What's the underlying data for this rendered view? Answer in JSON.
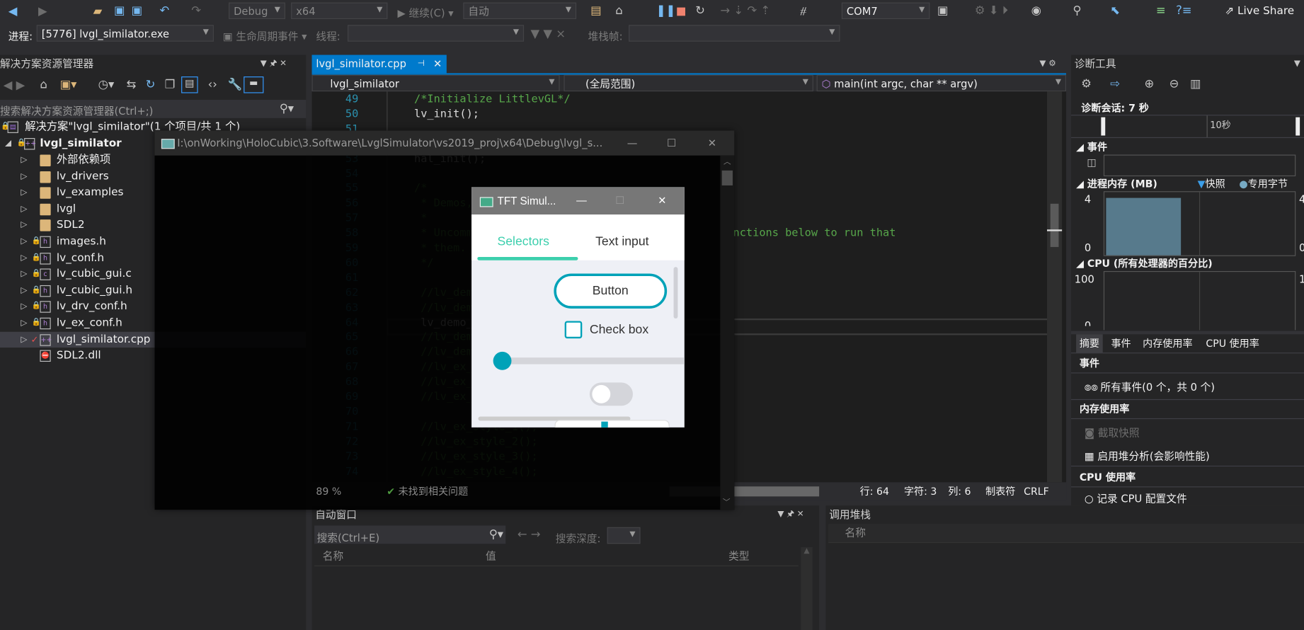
{
  "toolbar": {
    "config": "Debug",
    "platform": "x64",
    "continue": "继续(C)",
    "continue_mode": "自动",
    "device": "COM7",
    "live_share": "Live Share"
  },
  "debug_bar": {
    "process_label": "进程:",
    "process": "[5776] lvgl_similator.exe",
    "lifecycle": "生命周期事件",
    "thread_label": "线程:",
    "thread": "",
    "stack_label": "堆栈帧:",
    "stack": ""
  },
  "solution_explorer": {
    "title": "解决方案资源管理器",
    "search_placeholder": "搜索解决方案资源管理器(Ctrl+;)",
    "solution": "解决方案\"lvgl_similator\"(1 个项目/共 1 个)",
    "project": "lvgl_similator",
    "items": [
      {
        "label": "外部依赖项",
        "type": "deps"
      },
      {
        "label": "lv_drivers",
        "type": "folder"
      },
      {
        "label": "lv_examples",
        "type": "folder"
      },
      {
        "label": "lvgl",
        "type": "folder"
      },
      {
        "label": "SDL2",
        "type": "folder"
      },
      {
        "label": "images.h",
        "type": "h"
      },
      {
        "label": "lv_conf.h",
        "type": "h"
      },
      {
        "label": "lv_cubic_gui.c",
        "type": "c"
      },
      {
        "label": "lv_cubic_gui.h",
        "type": "h"
      },
      {
        "label": "lv_drv_conf.h",
        "type": "h"
      },
      {
        "label": "lv_ex_conf.h",
        "type": "h"
      },
      {
        "label": "lvgl_similator.cpp",
        "type": "cpp",
        "selected": true
      },
      {
        "label": "SDL2.dll",
        "type": "dll"
      }
    ]
  },
  "editor": {
    "tab": "lvgl_similator.cpp",
    "nav_project": "lvgl_similator",
    "nav_scope": "(全局范围)",
    "nav_member": "main(int argc, char ** argv)",
    "lines": [
      {
        "n": "49",
        "t": "/*Initialize LittlevGL*/",
        "c": "cm"
      },
      {
        "n": "50",
        "t": "lv_init();",
        "c": "df"
      },
      {
        "n": "51",
        "t": "",
        "c": "df"
      },
      {
        "n": "52",
        "t": "",
        "c": "cm"
      },
      {
        "n": "53",
        "t": "hal_init();",
        "c": "df"
      },
      {
        "n": "54",
        "t": "",
        "c": "df"
      },
      {
        "n": "55",
        "t": "/*",
        "c": "cm"
      },
      {
        "n": "56",
        "t": " * Demos,",
        "c": "cm"
      },
      {
        "n": "57",
        "t": " *",
        "c": "cm"
      },
      {
        "n": "58",
        "t": " * Uncomm                                      functions below to run that",
        "c": "cm"
      },
      {
        "n": "59",
        "t": " * them.",
        "c": "cm"
      },
      {
        "n": "60",
        "t": " */",
        "c": "cm"
      },
      {
        "n": "61",
        "t": "",
        "c": "df"
      },
      {
        "n": "62",
        "t": " //lv_dem",
        "c": "cm"
      },
      {
        "n": "63",
        "t": " //lv_dem",
        "c": "cm"
      },
      {
        "n": "64",
        "t": " lv_demo_",
        "c": "df"
      },
      {
        "n": "65",
        "t": " //lv_dem",
        "c": "cm"
      },
      {
        "n": "66",
        "t": " //lv_dem",
        "c": "cm"
      },
      {
        "n": "67",
        "t": " //lv_ex_",
        "c": "cm"
      },
      {
        "n": "68",
        "t": " //lv_ex_",
        "c": "cm"
      },
      {
        "n": "69",
        "t": " //lv_ex_",
        "c": "cm"
      },
      {
        "n": "70",
        "t": "",
        "c": "df"
      },
      {
        "n": "71",
        "t": " //lv_ex_style_1();",
        "c": "cm"
      },
      {
        "n": "72",
        "t": " //lv_ex_style_2();",
        "c": "cm"
      },
      {
        "n": "73",
        "t": " //lv_ex_style_3();",
        "c": "cm"
      },
      {
        "n": "74",
        "t": " //lv_ex_style_4();",
        "c": "cm"
      }
    ],
    "zoom": "89 %",
    "issues": "未找到相关问题",
    "status": {
      "line": "行: 64",
      "char": "字符: 3",
      "col": "列: 6",
      "tabs": "制表符",
      "eol": "CRLF"
    }
  },
  "console_window": {
    "title": "I:\\onWorking\\HoloCubic\\3.Software\\LvglSimulator\\vs2019_proj\\x64\\Debug\\lvgl_s..."
  },
  "tft_window": {
    "title": "TFT Simul...",
    "tabs": [
      "Selectors",
      "Text input"
    ],
    "active_tab": 0,
    "button": "Button",
    "checkbox": "Check box",
    "checkbox_checked": false,
    "slider_value": 0,
    "switch_on": false,
    "accent": "#00a2b8",
    "tab_indicator": "#3ccfad"
  },
  "diagnostics": {
    "title": "诊断工具",
    "session": "诊断会话: 7 秒",
    "timeline_tick": "10秒",
    "events_label": "事件",
    "memory_label": "进程内存 (MB)",
    "legend_snapshot": "快照",
    "legend_private": "专用字节",
    "mem_max": "4",
    "mem_min": "0",
    "cpu_label": "CPU (所有处理器的百分比)",
    "cpu_max": "100",
    "cpu_min": "0",
    "chart_data": {
      "type": "area",
      "series": [
        {
          "name": "专用字节",
          "values": [
            4,
            4
          ]
        }
      ],
      "ylim": [
        0,
        4
      ]
    },
    "tabs": [
      "摘要",
      "事件",
      "内存使用率",
      "CPU 使用率"
    ],
    "active_tab": 0,
    "summary": {
      "events_header": "事件",
      "all_events": "所有事件(0 个，共 0 个)",
      "memory_header": "内存使用率",
      "snapshot": "截取快照",
      "heap": "启用堆分析(会影响性能)",
      "cpu_header": "CPU 使用率",
      "cpu_record": "记录 CPU 配置文件"
    }
  },
  "autos": {
    "title": "自动窗口",
    "search_placeholder": "搜索(Ctrl+E)",
    "depth_label": "搜索深度:",
    "columns": [
      "名称",
      "值",
      "类型"
    ]
  },
  "callstack": {
    "title": "调用堆栈",
    "columns": [
      "名称"
    ]
  }
}
